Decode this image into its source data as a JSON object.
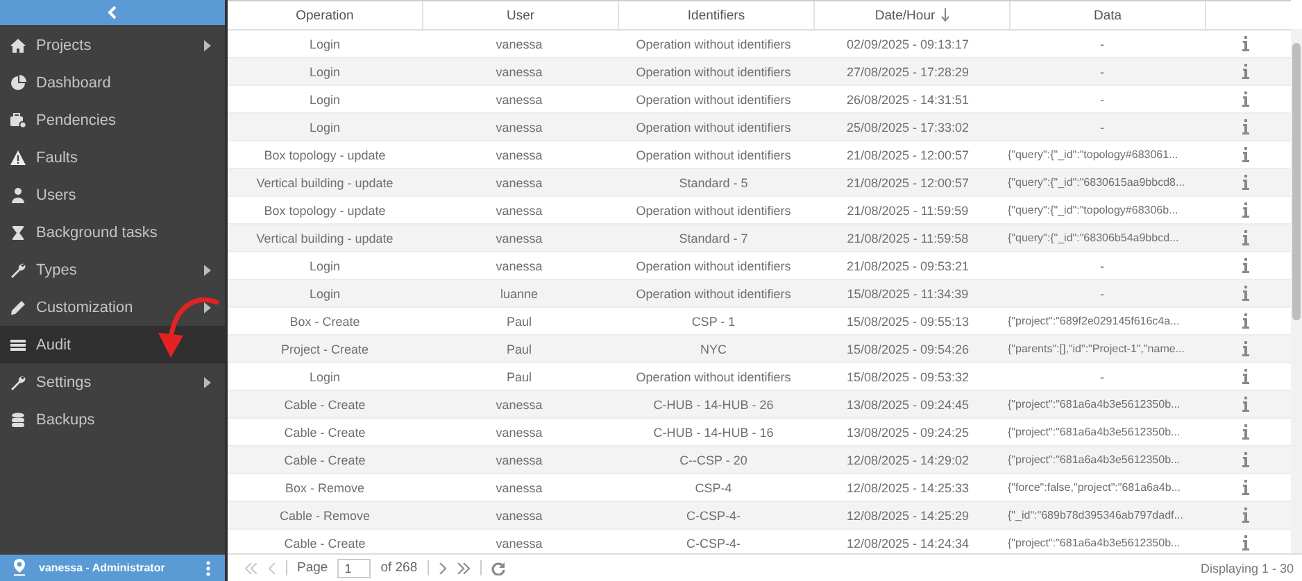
{
  "sidebar": {
    "items": [
      {
        "label": "Projects",
        "submenu": true,
        "selected": false
      },
      {
        "label": "Dashboard",
        "submenu": false,
        "selected": false
      },
      {
        "label": "Pendencies",
        "submenu": false,
        "selected": false
      },
      {
        "label": "Faults",
        "submenu": false,
        "selected": false
      },
      {
        "label": "Users",
        "submenu": false,
        "selected": false
      },
      {
        "label": "Background tasks",
        "submenu": false,
        "selected": false
      },
      {
        "label": "Types",
        "submenu": true,
        "selected": false
      },
      {
        "label": "Customization",
        "submenu": true,
        "selected": false
      },
      {
        "label": "Audit",
        "submenu": false,
        "selected": true
      },
      {
        "label": "Settings",
        "submenu": true,
        "selected": false
      },
      {
        "label": "Backups",
        "submenu": false,
        "selected": false
      }
    ],
    "user": "vanessa - Administrator"
  },
  "table": {
    "columns": [
      {
        "label": "Operation",
        "sorted": false
      },
      {
        "label": "User",
        "sorted": false
      },
      {
        "label": "Identifiers",
        "sorted": false
      },
      {
        "label": "Date/Hour",
        "sorted": true
      },
      {
        "label": "Data",
        "sorted": false
      }
    ],
    "rows": [
      [
        "Login",
        "vanessa",
        "Operation without identifiers",
        "02/09/2025 - 09:13:17",
        "-"
      ],
      [
        "Login",
        "vanessa",
        "Operation without identifiers",
        "27/08/2025 - 17:28:29",
        "-"
      ],
      [
        "Login",
        "vanessa",
        "Operation without identifiers",
        "26/08/2025 - 14:31:51",
        "-"
      ],
      [
        "Login",
        "vanessa",
        "Operation without identifiers",
        "25/08/2025 - 17:33:02",
        "-"
      ],
      [
        "Box topology - update",
        "vanessa",
        "Operation without identifiers",
        "21/08/2025 - 12:00:57",
        "{\"query\":{\"_id\":\"topology#683061..."
      ],
      [
        "Vertical building - update",
        "vanessa",
        "Standard - 5",
        "21/08/2025 - 12:00:57",
        "{\"query\":{\"_id\":\"6830615aa9bbcd8..."
      ],
      [
        "Box topology - update",
        "vanessa",
        "Operation without identifiers",
        "21/08/2025 - 11:59:59",
        "{\"query\":{\"_id\":\"topology#68306b..."
      ],
      [
        "Vertical building - update",
        "vanessa",
        "Standard - 7",
        "21/08/2025 - 11:59:58",
        "{\"query\":{\"_id\":\"68306b54a9bbcd..."
      ],
      [
        "Login",
        "vanessa",
        "Operation without identifiers",
        "21/08/2025 - 09:53:21",
        "-"
      ],
      [
        "Login",
        "luanne",
        "Operation without identifiers",
        "15/08/2025 - 11:34:39",
        "-"
      ],
      [
        "Box - Create",
        "Paul",
        "CSP - 1",
        "15/08/2025 - 09:55:13",
        "{\"project\":\"689f2e029145f616c4a..."
      ],
      [
        "Project - Create",
        "Paul",
        "NYC",
        "15/08/2025 - 09:54:26",
        "{\"parents\":[],\"id\":\"Project-1\",\"name..."
      ],
      [
        "Login",
        "Paul",
        "Operation without identifiers",
        "15/08/2025 - 09:53:32",
        "-"
      ],
      [
        "Cable - Create",
        "vanessa",
        "C-HUB - 14-HUB - 26",
        "13/08/2025 - 09:24:45",
        "{\"project\":\"681a6a4b3e5612350b..."
      ],
      [
        "Cable - Create",
        "vanessa",
        "C-HUB - 14-HUB - 16",
        "13/08/2025 - 09:24:25",
        "{\"project\":\"681a6a4b3e5612350b..."
      ],
      [
        "Cable - Create",
        "vanessa",
        "C--CSP - 20",
        "12/08/2025 - 14:29:02",
        "{\"project\":\"681a6a4b3e5612350b..."
      ],
      [
        "Box - Remove",
        "vanessa",
        "CSP-4",
        "12/08/2025 - 14:25:33",
        "{\"force\":false,\"project\":\"681a6a4b..."
      ],
      [
        "Cable - Remove",
        "vanessa",
        "C-CSP-4-",
        "12/08/2025 - 14:25:29",
        "{\"_id\":\"689b78d395346ab797dadf..."
      ],
      [
        "Cable - Create",
        "vanessa",
        "C-CSP-4-",
        "12/08/2025 - 14:24:34",
        "{\"project\":\"681a6a4b3e5612350b..."
      ]
    ]
  },
  "pager": {
    "page_label": "Page",
    "page": "1",
    "of": "of 268",
    "back_disabled": true,
    "display": "Displaying 1 - 30"
  }
}
